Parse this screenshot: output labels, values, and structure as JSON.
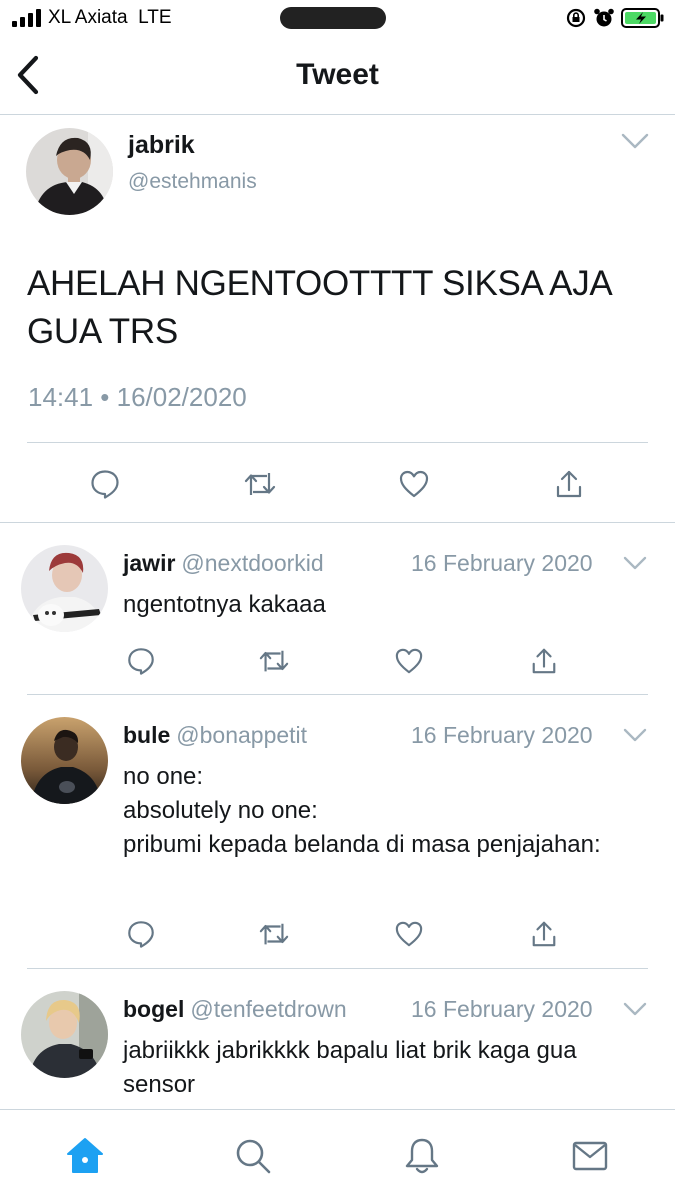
{
  "status_bar": {
    "carrier": "XL Axiata  LTE",
    "icons": [
      "signal-icon",
      "lock-rotation-icon",
      "alarm-icon",
      "battery-charging-icon"
    ]
  },
  "header": {
    "title": "Tweet",
    "back_icon": "chevron-left-icon"
  },
  "main_tweet": {
    "name": "jabrik",
    "handle": "@estehmanis",
    "text": "AHELAH NGENTOOTTTT SIKSA AJA GUA TRS",
    "time": "14:41 • 16/02/2020",
    "actions": [
      "reply-icon",
      "retweet-icon",
      "like-icon",
      "share-icon"
    ]
  },
  "replies": [
    {
      "name": "jawir",
      "handle": "@nextdoorkid",
      "date": "16 February 2020",
      "text": "ngentotnya kakaaa"
    },
    {
      "name": "bule",
      "handle": "@bonappetit",
      "date": "16 February 2020",
      "text": "no one:\nabsolutely no one:\npribumi kepada belanda di masa penjajahan:"
    },
    {
      "name": "bogel",
      "handle": "@tenfeetdrown",
      "date": "16 February 2020",
      "text": "jabriikkk jabrikkkk bapalu liat brik kaga gua sensor"
    }
  ],
  "tab_bar": {
    "tabs": [
      "home-icon",
      "search-icon",
      "notifications-icon",
      "messages-icon"
    ],
    "active": "home-icon"
  },
  "colors": {
    "accent": "#1da1f2",
    "icon_gray": "#657786",
    "secondary_text": "#8899a6",
    "divider": "#ccd6dd"
  }
}
